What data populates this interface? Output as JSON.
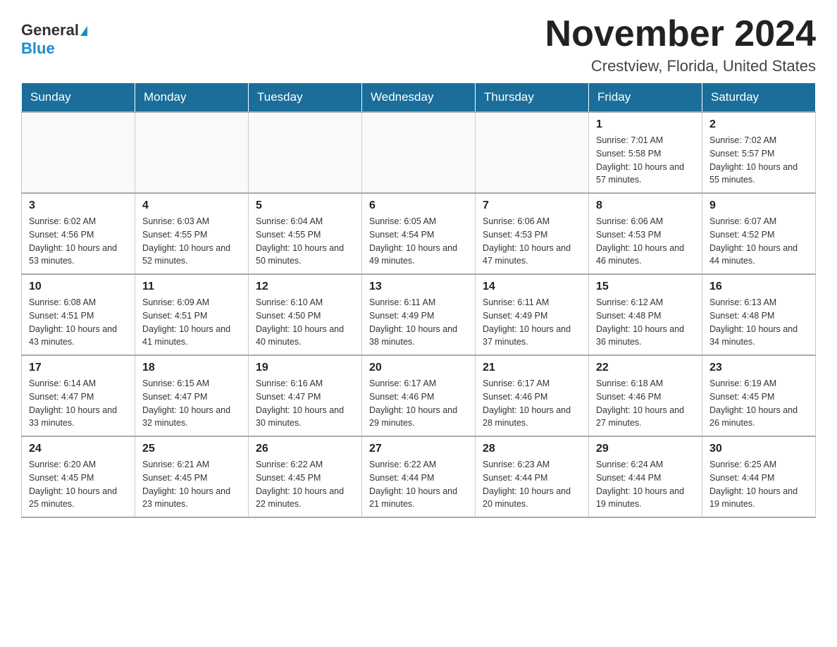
{
  "header": {
    "logo_general": "General",
    "logo_blue": "Blue",
    "month_year": "November 2024",
    "location": "Crestview, Florida, United States"
  },
  "calendar": {
    "days_of_week": [
      "Sunday",
      "Monday",
      "Tuesday",
      "Wednesday",
      "Thursday",
      "Friday",
      "Saturday"
    ],
    "weeks": [
      [
        {
          "day": "",
          "info": ""
        },
        {
          "day": "",
          "info": ""
        },
        {
          "day": "",
          "info": ""
        },
        {
          "day": "",
          "info": ""
        },
        {
          "day": "",
          "info": ""
        },
        {
          "day": "1",
          "info": "Sunrise: 7:01 AM\nSunset: 5:58 PM\nDaylight: 10 hours and 57 minutes."
        },
        {
          "day": "2",
          "info": "Sunrise: 7:02 AM\nSunset: 5:57 PM\nDaylight: 10 hours and 55 minutes."
        }
      ],
      [
        {
          "day": "3",
          "info": "Sunrise: 6:02 AM\nSunset: 4:56 PM\nDaylight: 10 hours and 53 minutes."
        },
        {
          "day": "4",
          "info": "Sunrise: 6:03 AM\nSunset: 4:55 PM\nDaylight: 10 hours and 52 minutes."
        },
        {
          "day": "5",
          "info": "Sunrise: 6:04 AM\nSunset: 4:55 PM\nDaylight: 10 hours and 50 minutes."
        },
        {
          "day": "6",
          "info": "Sunrise: 6:05 AM\nSunset: 4:54 PM\nDaylight: 10 hours and 49 minutes."
        },
        {
          "day": "7",
          "info": "Sunrise: 6:06 AM\nSunset: 4:53 PM\nDaylight: 10 hours and 47 minutes."
        },
        {
          "day": "8",
          "info": "Sunrise: 6:06 AM\nSunset: 4:53 PM\nDaylight: 10 hours and 46 minutes."
        },
        {
          "day": "9",
          "info": "Sunrise: 6:07 AM\nSunset: 4:52 PM\nDaylight: 10 hours and 44 minutes."
        }
      ],
      [
        {
          "day": "10",
          "info": "Sunrise: 6:08 AM\nSunset: 4:51 PM\nDaylight: 10 hours and 43 minutes."
        },
        {
          "day": "11",
          "info": "Sunrise: 6:09 AM\nSunset: 4:51 PM\nDaylight: 10 hours and 41 minutes."
        },
        {
          "day": "12",
          "info": "Sunrise: 6:10 AM\nSunset: 4:50 PM\nDaylight: 10 hours and 40 minutes."
        },
        {
          "day": "13",
          "info": "Sunrise: 6:11 AM\nSunset: 4:49 PM\nDaylight: 10 hours and 38 minutes."
        },
        {
          "day": "14",
          "info": "Sunrise: 6:11 AM\nSunset: 4:49 PM\nDaylight: 10 hours and 37 minutes."
        },
        {
          "day": "15",
          "info": "Sunrise: 6:12 AM\nSunset: 4:48 PM\nDaylight: 10 hours and 36 minutes."
        },
        {
          "day": "16",
          "info": "Sunrise: 6:13 AM\nSunset: 4:48 PM\nDaylight: 10 hours and 34 minutes."
        }
      ],
      [
        {
          "day": "17",
          "info": "Sunrise: 6:14 AM\nSunset: 4:47 PM\nDaylight: 10 hours and 33 minutes."
        },
        {
          "day": "18",
          "info": "Sunrise: 6:15 AM\nSunset: 4:47 PM\nDaylight: 10 hours and 32 minutes."
        },
        {
          "day": "19",
          "info": "Sunrise: 6:16 AM\nSunset: 4:47 PM\nDaylight: 10 hours and 30 minutes."
        },
        {
          "day": "20",
          "info": "Sunrise: 6:17 AM\nSunset: 4:46 PM\nDaylight: 10 hours and 29 minutes."
        },
        {
          "day": "21",
          "info": "Sunrise: 6:17 AM\nSunset: 4:46 PM\nDaylight: 10 hours and 28 minutes."
        },
        {
          "day": "22",
          "info": "Sunrise: 6:18 AM\nSunset: 4:46 PM\nDaylight: 10 hours and 27 minutes."
        },
        {
          "day": "23",
          "info": "Sunrise: 6:19 AM\nSunset: 4:45 PM\nDaylight: 10 hours and 26 minutes."
        }
      ],
      [
        {
          "day": "24",
          "info": "Sunrise: 6:20 AM\nSunset: 4:45 PM\nDaylight: 10 hours and 25 minutes."
        },
        {
          "day": "25",
          "info": "Sunrise: 6:21 AM\nSunset: 4:45 PM\nDaylight: 10 hours and 23 minutes."
        },
        {
          "day": "26",
          "info": "Sunrise: 6:22 AM\nSunset: 4:45 PM\nDaylight: 10 hours and 22 minutes."
        },
        {
          "day": "27",
          "info": "Sunrise: 6:22 AM\nSunset: 4:44 PM\nDaylight: 10 hours and 21 minutes."
        },
        {
          "day": "28",
          "info": "Sunrise: 6:23 AM\nSunset: 4:44 PM\nDaylight: 10 hours and 20 minutes."
        },
        {
          "day": "29",
          "info": "Sunrise: 6:24 AM\nSunset: 4:44 PM\nDaylight: 10 hours and 19 minutes."
        },
        {
          "day": "30",
          "info": "Sunrise: 6:25 AM\nSunset: 4:44 PM\nDaylight: 10 hours and 19 minutes."
        }
      ]
    ]
  }
}
